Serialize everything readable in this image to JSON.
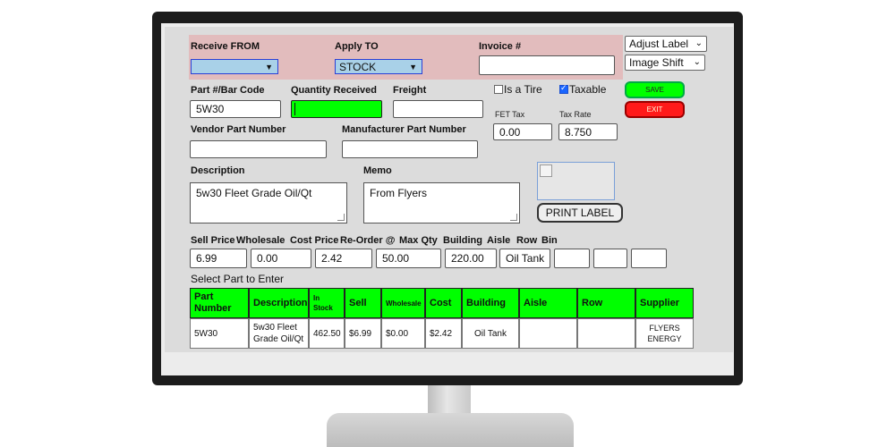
{
  "receive": {
    "receive_from_label": "Receive FROM",
    "receive_from_value": "",
    "apply_to_label": "Apply TO",
    "apply_to_value": "STOCK",
    "invoice_label": "Invoice #",
    "invoice_value": ""
  },
  "toolbar": {
    "adjust_label": "Adjust Label",
    "image_shift": "Image Shift",
    "save_label": "SAVE",
    "exit_label": "EXIT",
    "print_label": "PRINT LABEL"
  },
  "part": {
    "part_label": "Part #/Bar Code",
    "part_value": "5W30",
    "qty_label": "Quantity Received",
    "qty_value": "",
    "freight_label": "Freight",
    "freight_value": "",
    "is_tire_label": "Is a Tire",
    "is_tire_checked": false,
    "taxable_label": "Taxable",
    "taxable_checked": true,
    "fet_label": "FET Tax",
    "fet_value": "0.00",
    "tax_rate_label": "Tax Rate",
    "tax_rate_value": "8.750",
    "vendor_label": "Vendor Part Number",
    "vendor_value": "",
    "mfr_label": "Manufacturer Part Number",
    "mfr_value": "",
    "description_label": "Description",
    "description_value": "5w30 Fleet Grade Oil/Qt",
    "memo_label": "Memo",
    "memo_value": "From Flyers"
  },
  "pricing": {
    "labels": [
      "Sell Price",
      "Wholesale",
      "Cost Price",
      "Re-Order @",
      "Max Qty",
      "Building",
      "Aisle",
      "Row",
      "Bin"
    ],
    "sell": "6.99",
    "wholesale": "0.00",
    "cost": "2.42",
    "reorder": "50.00",
    "max_qty": "220.00",
    "building": "Oil Tank",
    "aisle": "",
    "row": "",
    "bin": ""
  },
  "grid": {
    "caption": "Select Part to Enter",
    "headers": [
      "Part Number",
      "Description",
      "In Stock",
      "Sell",
      "Wholesale",
      "Cost",
      "Building",
      "Aisle",
      "Row",
      "Supplier"
    ],
    "rows": [
      [
        "5W30",
        "5w30 Fleet Grade Oil/Qt",
        "462.50",
        "$6.99",
        "$0.00",
        "$2.42",
        "Oil Tank",
        "",
        "",
        "FLYERS ENERGY"
      ]
    ]
  }
}
